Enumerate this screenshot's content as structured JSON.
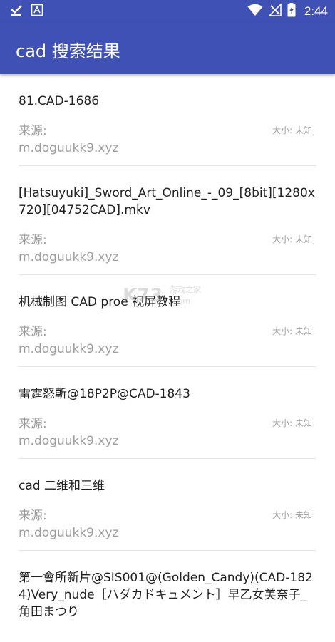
{
  "status_bar": {
    "time": "2:44",
    "icons": [
      "check-icon",
      "font-a-icon",
      "wifi-icon",
      "no-signal-icon",
      "battery-charging-icon"
    ]
  },
  "app_bar": {
    "title": "cad 搜索结果"
  },
  "results": [
    {
      "title": "81.CAD-1686",
      "source_label": "来源:",
      "source": "m.doguukk9.xyz",
      "size": "大小: 未知"
    },
    {
      "title": "[Hatsuyuki]_Sword_Art_Online_-_09_[8bit][1280x720][04752CAD].mkv",
      "source_label": "来源:",
      "source": "m.doguukk9.xyz",
      "size": "大小: 未知"
    },
    {
      "title": "机械制图 CAD proe 视屏教程",
      "source_label": "来源:",
      "source": "m.doguukk9.xyz",
      "size": "大小: 未知"
    },
    {
      "title": "雷霆怒斬@18P2P@CAD-1843",
      "source_label": "来源:",
      "source": "m.doguukk9.xyz",
      "size": "大小: 未知"
    },
    {
      "title": "cad 二维和三维",
      "source_label": "来源:",
      "source": "m.doguukk9.xyz",
      "size": "大小: 未知"
    },
    {
      "title": "第一會所新片@SIS001@(Golden_Candy)(CAD-1824)Very_nude［ハダカドキュメント］早乙女美奈子_角田まつり",
      "source_label": "",
      "source": "",
      "size": ""
    }
  ],
  "watermark": {
    "logo": "K73",
    "text": "游戏之家",
    "domain": ".com"
  },
  "colors": {
    "primary": "#3f51b5",
    "text_primary": "#212121",
    "text_secondary": "#9e9e9e",
    "divider": "#e6e6e6"
  }
}
